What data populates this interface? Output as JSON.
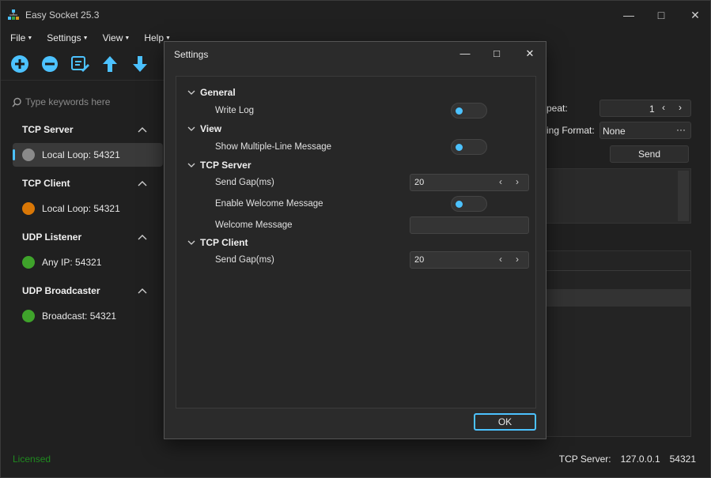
{
  "app": {
    "title": "Easy Socket 25.3"
  },
  "menu": [
    "File",
    "Settings",
    "View",
    "Help"
  ],
  "toolbar": {
    "icons": [
      "add-icon",
      "remove-icon",
      "edit-icon",
      "up-arrow-icon",
      "down-arrow-icon"
    ]
  },
  "sidebar": {
    "search_placeholder": "Type keywords here",
    "sections": [
      {
        "title": "TCP Server",
        "items": [
          {
            "label": "Local Loop: 54321",
            "color": "#8a8a8a",
            "selected": true
          }
        ]
      },
      {
        "title": "TCP Client",
        "items": [
          {
            "label": "Local Loop: 54321",
            "color": "#d97706",
            "selected": false
          }
        ]
      },
      {
        "title": "UDP Listener",
        "items": [
          {
            "label": "Any IP: 54321",
            "color": "#3fa32b",
            "selected": false
          }
        ]
      },
      {
        "title": "UDP Broadcaster",
        "items": [
          {
            "label": "Broadcast: 54321",
            "color": "#3fa32b",
            "selected": false
          }
        ]
      }
    ]
  },
  "right_panel": {
    "repeat_label": "peat:",
    "repeat_value": "1",
    "format_label": "ing Format:",
    "format_value": "None",
    "more_label": "···",
    "send_label": "Send"
  },
  "footer": {
    "license": "Licensed",
    "server": "TCP Server:",
    "ip": "127.0.0.1",
    "port": "54321"
  },
  "dialog": {
    "title": "Settings",
    "ok_label": "OK",
    "groups": {
      "general": {
        "title": "General",
        "write_log": "Write Log"
      },
      "view": {
        "title": "View",
        "show_multiline": "Show Multiple-Line Message"
      },
      "tcp_server": {
        "title": "TCP Server",
        "send_gap": "Send Gap(ms)",
        "send_gap_value": "20",
        "enable_welcome": "Enable Welcome Message",
        "welcome_message": "Welcome Message",
        "welcome_value": ""
      },
      "tcp_client": {
        "title": "TCP Client",
        "send_gap": "Send Gap(ms)",
        "send_gap_value": "20"
      }
    }
  },
  "colors": {
    "accent": "#4cc2ff",
    "add_icon": "#4cc2ff"
  }
}
